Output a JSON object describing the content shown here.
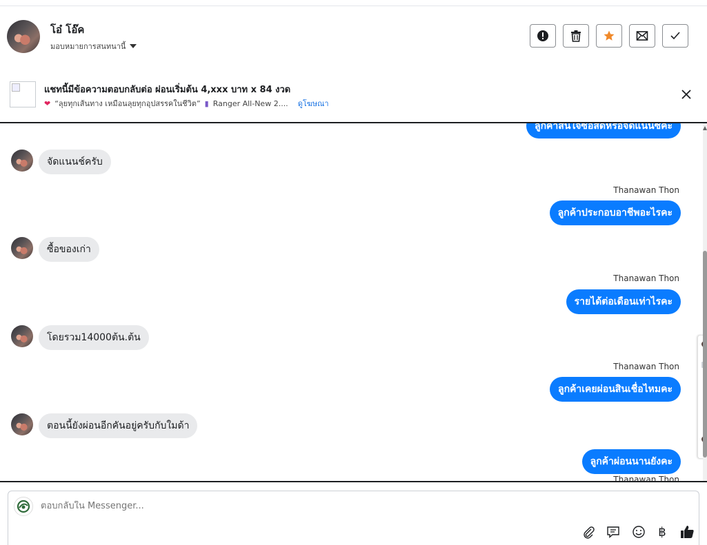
{
  "header": {
    "user_name": "โอ๋ โอ๊ค",
    "assign_label": "มอบหมายการสนทนานี้",
    "actions": [
      "mark-spam",
      "delete",
      "star",
      "mark-unread",
      "mark-done"
    ]
  },
  "ad": {
    "title": "แชทนี้มีข้อความตอบกลับต่อ ผ่อนเริ่มต้น 4,xxx บาท x 84 งวด",
    "subtitle": "“ลุยทุกเส้นทาง เหมือนลุยทุกอุปสรรคในชีวิต”",
    "subtitle2": "Ranger All-New 2....",
    "link": "ดูโฆษณา"
  },
  "messages": [
    {
      "dir": "out",
      "text": "ลูกค้าสนใจซื้อสดหรือจัดแนนซ์คะ"
    },
    {
      "dir": "in",
      "text": "จัดแนนช์ครับ"
    },
    {
      "dir": "out",
      "sender": "Thanawan Thon",
      "text": "ลูกค้าประกอบอาชีพอะไรคะ"
    },
    {
      "dir": "in",
      "text": "ซื้อของเก่า"
    },
    {
      "dir": "out",
      "sender": "Thanawan Thon",
      "text": "รายได้ต่อเดือนเท่าไรคะ"
    },
    {
      "dir": "in",
      "text": "โดยรวม14000ต้น.ต้น"
    },
    {
      "dir": "out",
      "sender": "Thanawan Thon",
      "text": "ลูกค้าเคยผ่อนสินเชื่อไหมคะ"
    },
    {
      "dir": "in",
      "text": "ตอนนี้ยังผ่อนอีกคันอยู่ครับกับใมด้า"
    },
    {
      "dir": "out",
      "sender": "Thanawan Thon",
      "text": "ลูกค้าผ่อนนานยังคะ"
    },
    {
      "dir": "out",
      "sender": "Thanawan Thon",
      "text": ""
    }
  ],
  "composer": {
    "placeholder": "ตอบกลับใน Messenger...",
    "tools": [
      "attachment-icon",
      "saved-reply-icon",
      "emoji-icon",
      "baht-payment-icon",
      "thumbs-up-icon"
    ],
    "baht_symbol": "฿"
  },
  "colors": {
    "accent": "#0a7cff",
    "incoming_bubble": "#e9eaec",
    "star": "#f0892a"
  }
}
